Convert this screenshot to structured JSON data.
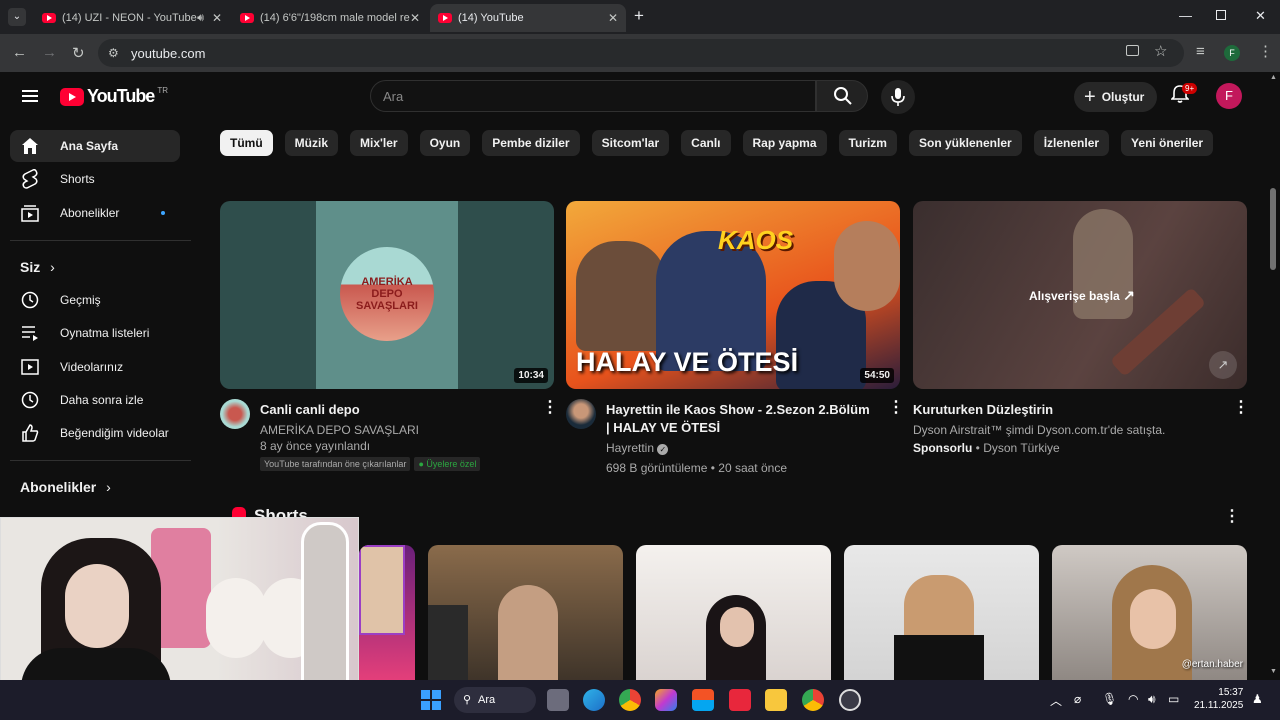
{
  "browser": {
    "tabs": [
      {
        "label": "(14) UZI - NEON - YouTube"
      },
      {
        "label": "(14) 6'6\"/198cm male model re"
      },
      {
        "label": "(14) YouTube"
      }
    ],
    "url": "youtube.com",
    "profile_initial": "F"
  },
  "header": {
    "logo_text": "YouTube",
    "region": "TR",
    "search_placeholder": "Ara",
    "create_label": "Oluştur",
    "notification_count": "9+",
    "avatar_initial": "F"
  },
  "sidebar": {
    "main": [
      {
        "label": "Ana Sayfa",
        "icon": "home-icon"
      },
      {
        "label": "Shorts",
        "icon": "shorts-icon"
      },
      {
        "label": "Abonelikler",
        "icon": "subscriptions-icon"
      }
    ],
    "you_heading": "Siz",
    "you_items": [
      {
        "label": "Geçmiş",
        "icon": "history-icon"
      },
      {
        "label": "Oynatma listeleri",
        "icon": "playlist-icon"
      },
      {
        "label": "Videolarınız",
        "icon": "your-videos-icon"
      },
      {
        "label": "Daha sonra izle",
        "icon": "watch-later-icon"
      },
      {
        "label": "Beğendiğim videolar",
        "icon": "liked-icon"
      }
    ],
    "subs_heading": "Abonelikler"
  },
  "chips": [
    "Tümü",
    "Müzik",
    "Mix'ler",
    "Oyun",
    "Pembe diziler",
    "Sitcom'lar",
    "Canlı",
    "Rap yapma",
    "Turizm",
    "Son yüklenenler",
    "İzlenenler",
    "Yeni öneriler"
  ],
  "videos": [
    {
      "title": "Canli canli depo",
      "channel": "AMERİKA DEPO SAVAŞLARI",
      "stats": "8 ay önce yayınlandı",
      "duration": "10:34",
      "thumb_text": "AMERİKA DEPO SAVAŞLARI",
      "badges": [
        "YouTube tarafından öne çıkarılanlar",
        "Üyelere özel"
      ]
    },
    {
      "title": "Hayrettin ile Kaos Show - 2.Sezon 2.Bölüm | HALAY VE ÖTESİ",
      "channel": "Hayrettin",
      "stats": "698 B görüntüleme • 20 saat önce",
      "duration": "54:50",
      "thumb_text": "HALAY VE ÖTESİ",
      "thumb_logo": "KAOS"
    },
    {
      "title": "Kuruturken Düzleştirin",
      "channel": "Dyson Airstrait™ şimdi Dyson.com.tr'de satışta.",
      "sponsor": "Sponsorlu",
      "advertiser": "Dyson Türkiye",
      "cta": "Alışverişe başla"
    }
  ],
  "shorts": {
    "heading": "Shorts",
    "watermark": "@ertan.haber"
  },
  "taskbar": {
    "search_label": "Ara",
    "time": "15:37",
    "date": "21.11.2025"
  }
}
